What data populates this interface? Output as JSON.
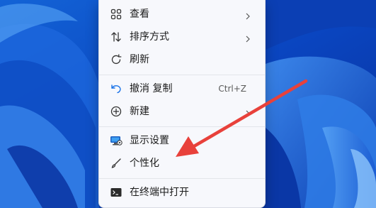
{
  "menu": {
    "items": [
      {
        "label": "查看",
        "icon": "grid-view-icon",
        "submenu": true
      },
      {
        "label": "排序方式",
        "icon": "sort-arrows-icon",
        "submenu": true
      },
      {
        "label": "刷新",
        "icon": "refresh-icon",
        "submenu": false
      },
      {
        "label": "撤消 复制",
        "icon": "undo-icon",
        "shortcut": "Ctrl+Z",
        "submenu": false
      },
      {
        "label": "新建",
        "icon": "new-plus-icon",
        "submenu": true
      },
      {
        "label": "显示设置",
        "icon": "display-settings-icon",
        "submenu": false
      },
      {
        "label": "个性化",
        "icon": "brush-icon",
        "submenu": false
      },
      {
        "label": "在终端中打开",
        "icon": "terminal-icon",
        "submenu": false
      }
    ]
  },
  "colors": {
    "accent": "#0a5cd8",
    "annotation_arrow": "#e8413b",
    "menu_background": "#f7f8fc"
  }
}
